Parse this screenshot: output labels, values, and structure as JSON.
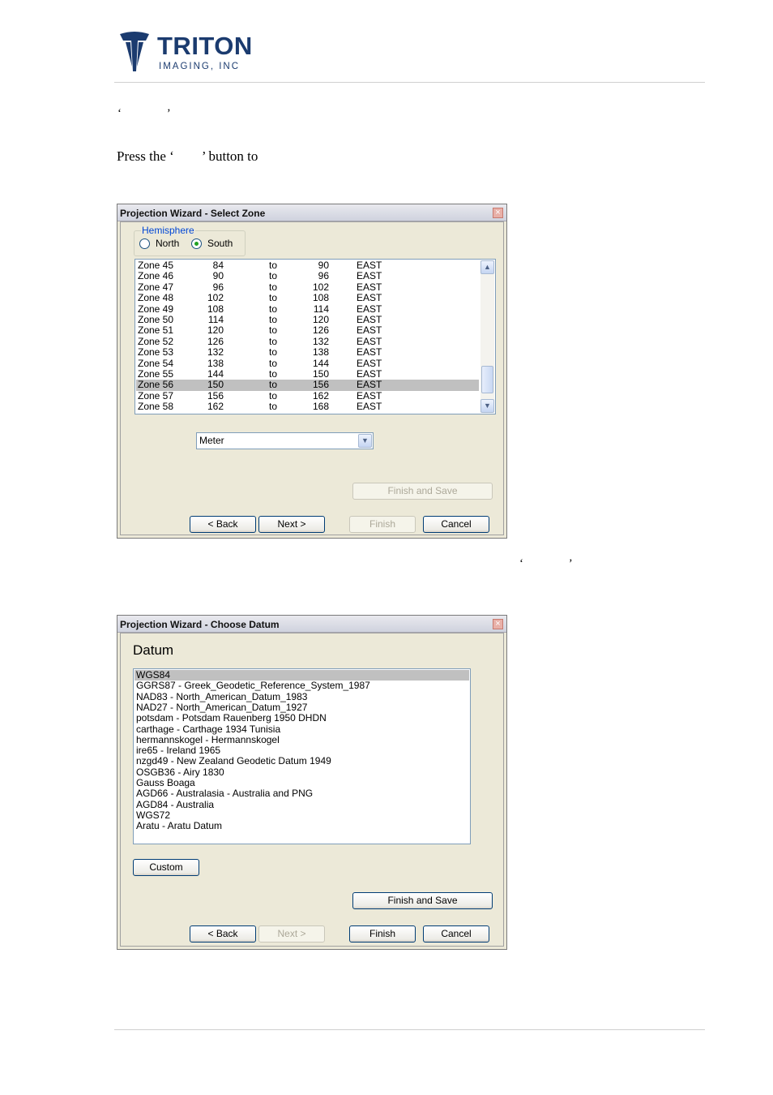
{
  "header": {
    "company": "TRITON",
    "company_sub": "IMAGING, INC"
  },
  "doc": {
    "quote_line1": "‘ ’",
    "para_prefix": "Press the ‘",
    "para_suffix": "’ button to",
    "quote_mid": "‘ ’"
  },
  "zone_dialog": {
    "title": "Projection Wizard - Select Zone",
    "hemisphere_label": "Hemisphere",
    "north_label": "North",
    "south_label": "South",
    "selected_hemisphere": "South",
    "zones": [
      {
        "name": "Zone 45",
        "from": "84",
        "to_word": "to",
        "to": "90",
        "dir": "EAST"
      },
      {
        "name": "Zone 46",
        "from": "90",
        "to_word": "to",
        "to": "96",
        "dir": "EAST"
      },
      {
        "name": "Zone 47",
        "from": "96",
        "to_word": "to",
        "to": "102",
        "dir": "EAST"
      },
      {
        "name": "Zone 48",
        "from": "102",
        "to_word": "to",
        "to": "108",
        "dir": "EAST"
      },
      {
        "name": "Zone 49",
        "from": "108",
        "to_word": "to",
        "to": "114",
        "dir": "EAST"
      },
      {
        "name": "Zone 50",
        "from": "114",
        "to_word": "to",
        "to": "120",
        "dir": "EAST"
      },
      {
        "name": "Zone 51",
        "from": "120",
        "to_word": "to",
        "to": "126",
        "dir": "EAST"
      },
      {
        "name": "Zone 52",
        "from": "126",
        "to_word": "to",
        "to": "132",
        "dir": "EAST"
      },
      {
        "name": "Zone 53",
        "from": "132",
        "to_word": "to",
        "to": "138",
        "dir": "EAST"
      },
      {
        "name": "Zone 54",
        "from": "138",
        "to_word": "to",
        "to": "144",
        "dir": "EAST"
      },
      {
        "name": "Zone 55",
        "from": "144",
        "to_word": "to",
        "to": "150",
        "dir": "EAST"
      },
      {
        "name": "Zone 56",
        "from": "150",
        "to_word": "to",
        "to": "156",
        "dir": "EAST"
      },
      {
        "name": "Zone 57",
        "from": "156",
        "to_word": "to",
        "to": "162",
        "dir": "EAST"
      },
      {
        "name": "Zone 58",
        "from": "162",
        "to_word": "to",
        "to": "168",
        "dir": "EAST"
      }
    ],
    "selected_zone": "Zone 56",
    "unit_value": "Meter",
    "finish_save_label": "Finish and Save",
    "back_label": "< Back",
    "next_label": "Next >",
    "finish_label": "Finish",
    "cancel_label": "Cancel"
  },
  "datum_dialog": {
    "title": "Projection Wizard - Choose Datum",
    "heading": "Datum",
    "datums": [
      "WGS84",
      "GGRS87 - Greek_Geodetic_Reference_System_1987",
      "NAD83 - North_American_Datum_1983",
      "NAD27 - North_American_Datum_1927",
      "potsdam - Potsdam Rauenberg 1950 DHDN",
      "carthage - Carthage 1934 Tunisia",
      "hermannskogel - Hermannskogel",
      "ire65 - Ireland 1965",
      "nzgd49 - New Zealand Geodetic Datum 1949",
      "OSGB36 - Airy 1830",
      "Gauss Boaga",
      "AGD66 - Australasia - Australia and PNG",
      "AGD84 - Australia",
      "WGS72",
      "Aratu - Aratu Datum"
    ],
    "selected_datum": "WGS84",
    "custom_label": "Custom",
    "finish_save_label": "Finish and Save",
    "back_label": "< Back",
    "next_label": "Next >",
    "finish_label": "Finish",
    "cancel_label": "Cancel"
  }
}
